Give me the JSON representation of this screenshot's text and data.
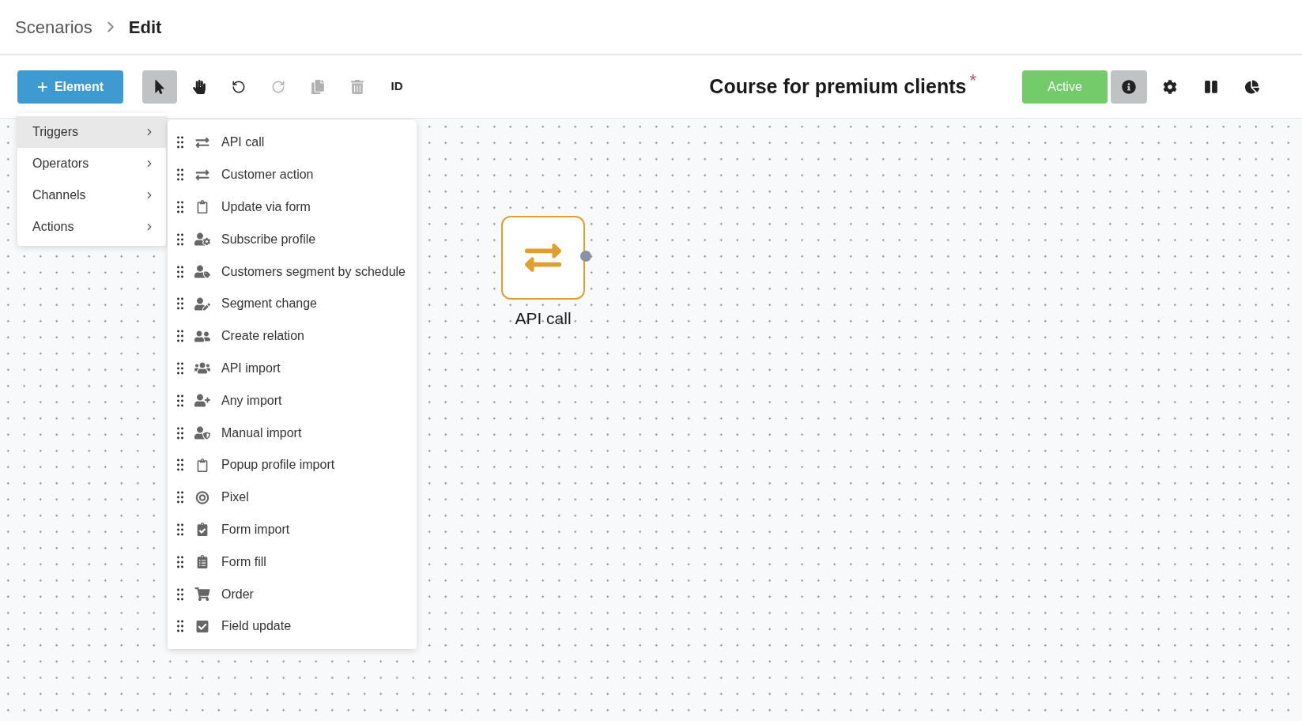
{
  "breadcrumb": {
    "items": [
      "Scenarios",
      "Edit"
    ]
  },
  "toolbar": {
    "add_button": {
      "icon": "+",
      "label": "Element"
    },
    "tools": [
      {
        "selected": true,
        "disabled": false
      },
      {
        "selected": false,
        "disabled": false
      },
      {
        "selected": false,
        "disabled": false
      },
      {
        "selected": false,
        "disabled": true
      },
      {
        "selected": false,
        "disabled": true
      },
      {
        "selected": false,
        "disabled": true
      },
      {
        "selected": false,
        "disabled": false,
        "label": "ID"
      }
    ],
    "title": "Course for premium clients",
    "unsaved_mark": "*",
    "status_button": {
      "label": "Active",
      "on": true
    },
    "actions": [
      {
        "selected": true
      },
      {
        "selected": false
      },
      {
        "selected": false
      },
      {
        "selected": false
      }
    ]
  },
  "menu": {
    "items": [
      {
        "label": "Triggers",
        "selected": true
      },
      {
        "label": "Operators",
        "selected": false
      },
      {
        "label": "Channels",
        "selected": false
      },
      {
        "label": "Actions",
        "selected": false
      }
    ]
  },
  "submenu": {
    "items": [
      "API call",
      "Customer action",
      "Update via form",
      "Subscribe profile",
      "Customers segment by schedule",
      "Segment change",
      "Create relation",
      "API import",
      "Any import",
      "Manual import",
      "Popup profile import",
      "Pixel",
      "Form import",
      "Form fill",
      "Order",
      "Field update"
    ]
  },
  "canvas": {
    "nodes": [
      {
        "label": "API call"
      }
    ]
  }
}
